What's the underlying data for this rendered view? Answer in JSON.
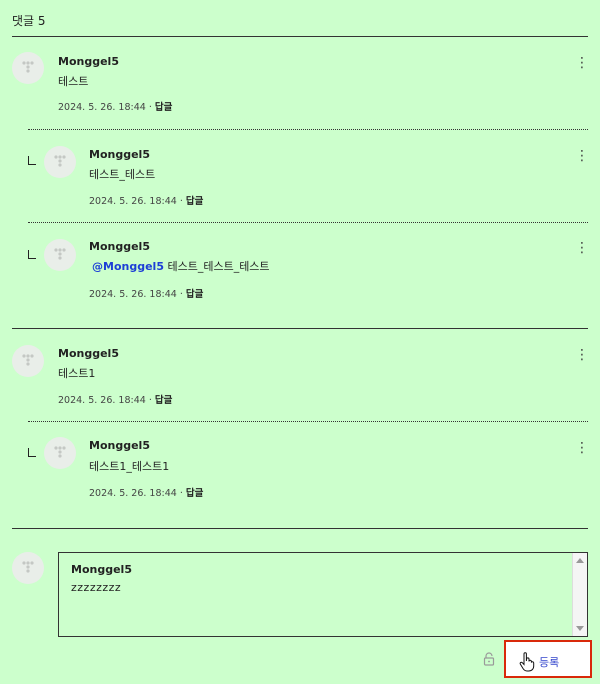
{
  "header": {
    "title": "댓글 5"
  },
  "icons": {
    "avatar": "default-avatar-icon",
    "more": "more-vertical-icon",
    "reply_indent": "reply-indent-icon",
    "lock": "lock-icon",
    "cursor": "hand-pointer-icon"
  },
  "comments": [
    {
      "author": "Monggel5",
      "text": "테스트",
      "date": "2024. 5. 26. 18:44",
      "reply_label": "답글",
      "more": "⋮"
    },
    {
      "author": "Monggel5",
      "text": "테스트_테스트",
      "date": "2024. 5. 26. 18:44",
      "reply_label": "답글",
      "more": "⋮"
    },
    {
      "author": "Monggel5",
      "mention": "@Monggel5",
      "text": "테스트_테스트_테스트",
      "date": "2024. 5. 26. 18:44",
      "reply_label": "답글",
      "more": "⋮"
    },
    {
      "author": "Monggel5",
      "text": "테스트1",
      "date": "2024. 5. 26. 18:44",
      "reply_label": "답글",
      "more": "⋮"
    },
    {
      "author": "Monggel5",
      "text": "테스트1_테스트1",
      "date": "2024. 5. 26. 18:44",
      "reply_label": "답글",
      "more": "⋮"
    }
  ],
  "composer": {
    "author": "Monggel5",
    "value": "zzzzzzzz"
  },
  "submit": {
    "label": "등록"
  },
  "colors": {
    "background": "#ccffcc",
    "mention": "#1d3fd6",
    "submit_text": "#3344cc",
    "highlight_border": "#d9290a"
  }
}
